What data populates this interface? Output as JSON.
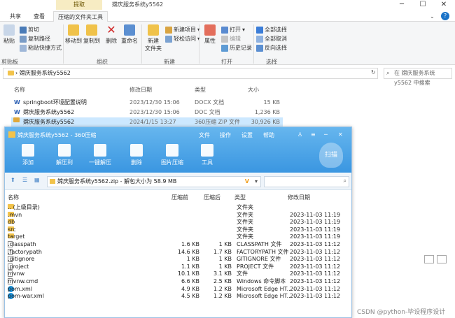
{
  "explorer": {
    "context_tab": "提取",
    "title": "嫦庆服务系统y5562",
    "tabs": [
      "共享",
      "查看",
      "压缩的文件夹工具"
    ],
    "ribbon": {
      "paste": "粘贴",
      "cut": "剪切",
      "copy_path": "复制路径",
      "paste_shortcut": "粘贴快捷方式",
      "clipboard_group": "剪贴板",
      "move_to": "移动到",
      "copy_to": "复制到",
      "delete": "删除",
      "rename": "重命名",
      "organize_group": "组织",
      "new_folder": "新建\n文件夹",
      "new_item": "新建项目",
      "easy_access": "轻松访问",
      "new_group": "新建",
      "properties": "属性",
      "open": "打开",
      "edit": "编辑",
      "history": "历史记录",
      "open_group": "打开",
      "select_all": "全部选择",
      "select_none": "全部取消",
      "invert_select": "反向选择",
      "select_group": "选择"
    },
    "address": "嫦庆服务系统y5562",
    "search_placeholder": "在 嫦庆服务系统y5562 中搜索",
    "columns": [
      "名称",
      "修改日期",
      "类型",
      "大小"
    ],
    "files": [
      {
        "name": "springboot环境配置说明",
        "date": "2023/12/30 15:06",
        "type": "DOCX 文档",
        "size": "15 KB"
      },
      {
        "name": "嫦庆服务系统y5562",
        "date": "2023/12/30 15:06",
        "type": "DOC 文档",
        "size": "1,236 KB"
      },
      {
        "name": "嫦庆服务系统y5562",
        "date": "2024/1/15 13:27",
        "type": "360压缩 ZIP 文件",
        "size": "30,926 KB"
      }
    ]
  },
  "zip": {
    "title": "嫦庆服务系统y5562 - 360压缩",
    "menu": [
      "文件",
      "操作",
      "设置",
      "帮助"
    ],
    "tools": [
      "添加",
      "解压到",
      "一键解压",
      "删除",
      "图片压缩",
      "工具"
    ],
    "scan": "扫描",
    "path": "嫦庆服务系统y5562.zip - 解包大小为 58.9 MB",
    "columns": [
      "名称",
      "压缩前",
      "压缩后",
      "类型",
      "修改日期"
    ],
    "rows": [
      {
        "icon": "folder",
        "name": ".. (上级目录)",
        "before": "",
        "after": "",
        "type": "文件夹",
        "date": ""
      },
      {
        "icon": "folder",
        "name": ".mvn",
        "before": "",
        "after": "",
        "type": "文件夹",
        "date": "2023-11-03 11:19"
      },
      {
        "icon": "folder",
        "name": "db",
        "before": "",
        "after": "",
        "type": "文件夹",
        "date": "2023-11-03 11:19"
      },
      {
        "icon": "folder",
        "name": "src",
        "before": "",
        "after": "",
        "type": "文件夹",
        "date": "2023-11-03 11:19"
      },
      {
        "icon": "folder",
        "name": "target",
        "before": "",
        "after": "",
        "type": "文件夹",
        "date": "2023-11-03 11:19"
      },
      {
        "icon": "file",
        "name": ".classpath",
        "before": "1.6 KB",
        "after": "1 KB",
        "type": "CLASSPATH 文件",
        "date": "2023-11-03 11:12"
      },
      {
        "icon": "file",
        "name": ".factorypath",
        "before": "14.6 KB",
        "after": "1.7 KB",
        "type": "FACTORYPATH 文件",
        "date": "2023-11-03 11:12"
      },
      {
        "icon": "file",
        "name": ".gitignore",
        "before": "1 KB",
        "after": "1 KB",
        "type": "GITIGNORE 文件",
        "date": "2023-11-03 11:12"
      },
      {
        "icon": "file",
        "name": ".project",
        "before": "1.1 KB",
        "after": "1 KB",
        "type": "PROJECT 文件",
        "date": "2023-11-03 11:12"
      },
      {
        "icon": "file",
        "name": "mvnw",
        "before": "10.1 KB",
        "after": "3.1 KB",
        "type": "文件",
        "date": "2023-11-03 11:12"
      },
      {
        "icon": "file",
        "name": "mvnw.cmd",
        "before": "6.6 KB",
        "after": "2.5 KB",
        "type": "Windows 命令脚本",
        "date": "2023-11-03 11:12"
      },
      {
        "icon": "edge",
        "name": "pom.xml",
        "before": "4.9 KB",
        "after": "1.2 KB",
        "type": "Microsoft Edge HT...",
        "date": "2023-11-03 11:12"
      },
      {
        "icon": "edge",
        "name": "pom-war.xml",
        "before": "4.5 KB",
        "after": "1.2 KB",
        "type": "Microsoft Edge HT...",
        "date": "2023-11-03 11:12"
      }
    ]
  },
  "watermark": "CSDN @python-毕设程序设计"
}
